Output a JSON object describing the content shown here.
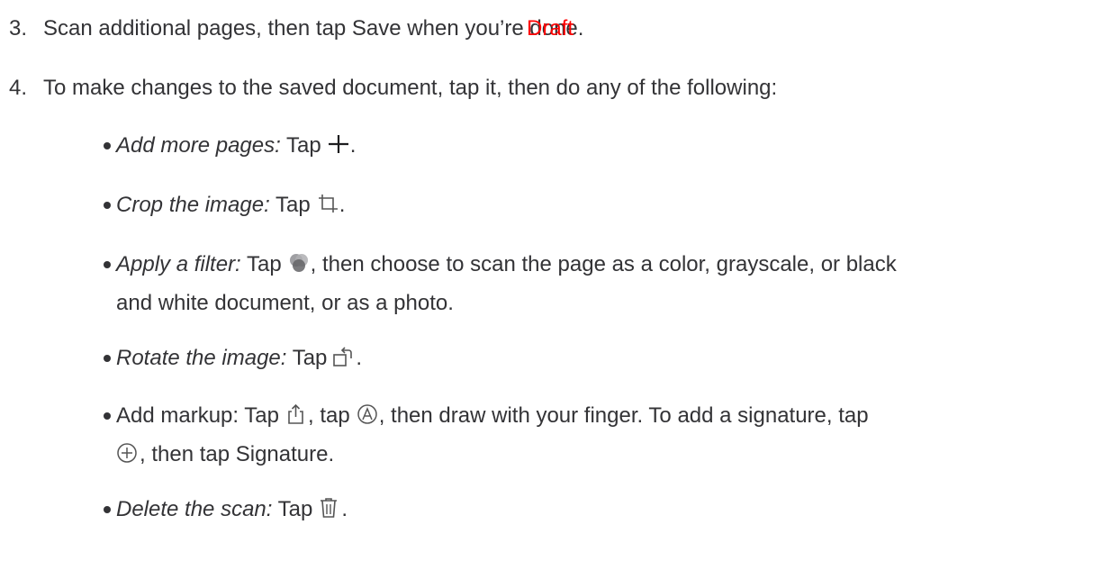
{
  "watermark": "Draft",
  "steps": [
    {
      "number": "3.",
      "text": "Scan additional pages, then tap Save when you’re done."
    },
    {
      "number": "4.",
      "text": "To make changes to the saved document, tap it, then do any of the following:"
    }
  ],
  "bullets": [
    {
      "label": "Add more pages:",
      "prefix": " Tap",
      "icon": "plus-icon",
      "suffix": "."
    },
    {
      "label": "Crop the image:",
      "prefix": " Tap",
      "icon": "crop-icon",
      "suffix": "."
    },
    {
      "label": "Apply a filter:",
      "prefix": " Tap",
      "icon": "filters-icon",
      "suffix": ", then choose to scan the page as a color, grayscale, or black",
      "line2": "and white document, or as a photo."
    },
    {
      "label": "Rotate the image:",
      "prefix": " Tap",
      "icon": "rotate-icon",
      "suffix": "."
    },
    {
      "lead": "Add markup: Tap",
      "icon": "share-icon",
      "mid": ", tap",
      "icon2": "markup-icon",
      "suffix": ", then draw with your finger. To add a signature, tap",
      "icon3": "add-circle-icon",
      "line2": ", then tap Signature."
    },
    {
      "label": "Delete the scan:",
      "prefix": " Tap",
      "icon": "trash-icon",
      "suffix": "."
    }
  ],
  "colors": {
    "text": "#333336",
    "watermark": "#ff0000"
  }
}
